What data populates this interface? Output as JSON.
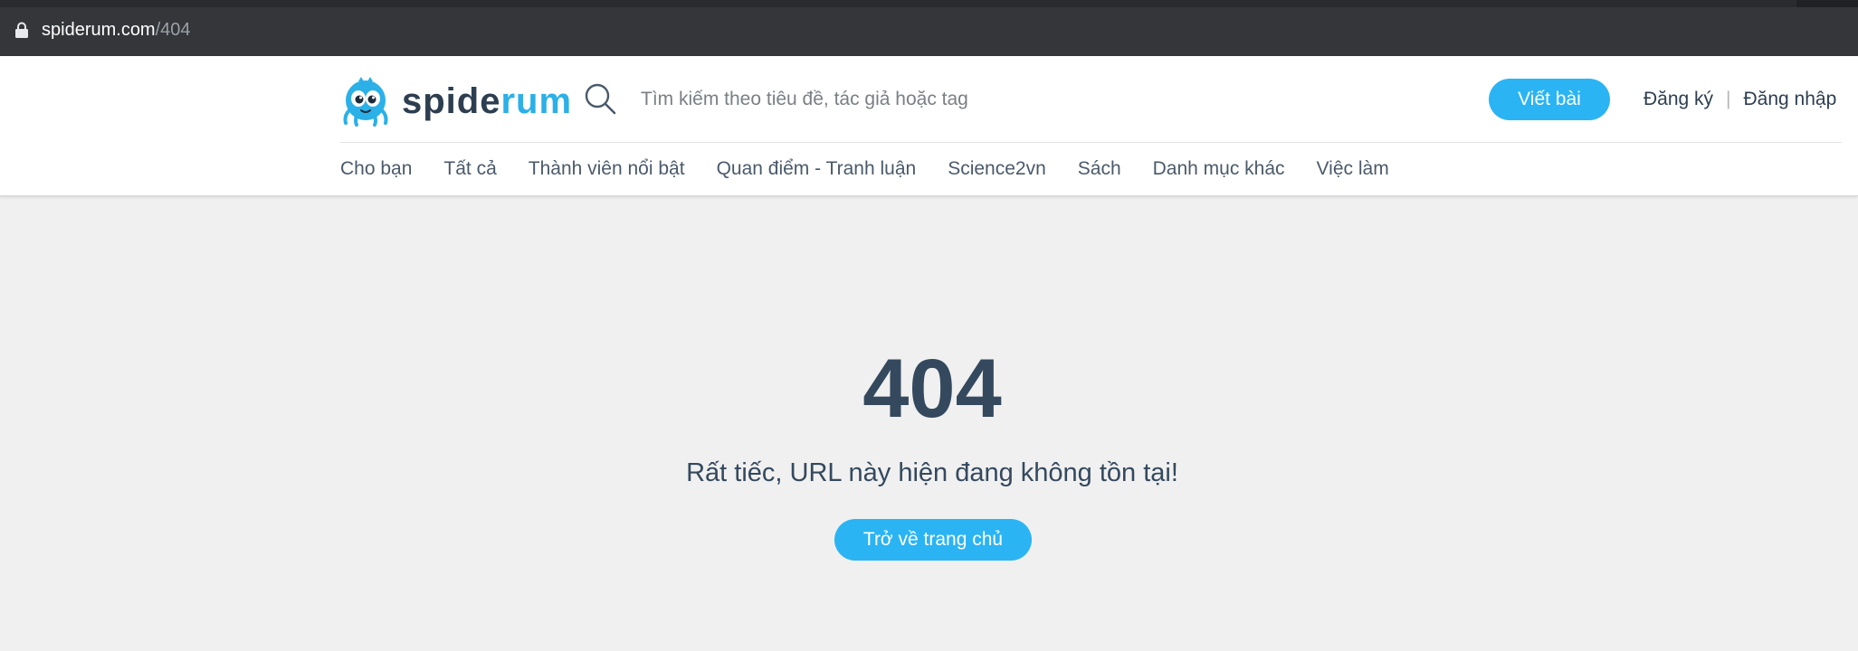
{
  "browser": {
    "url_host": "spiderum.com",
    "url_path": "/404"
  },
  "header": {
    "logo": {
      "text_dark": "spide",
      "text_accent": "rum"
    },
    "search": {
      "placeholder": "Tìm kiếm theo tiêu đề, tác giả hoặc tag"
    },
    "write_button": "Viết bài",
    "register_link": "Đăng ký",
    "separator": "|",
    "login_link": "Đăng nhập",
    "nav": [
      {
        "label": "Cho bạn"
      },
      {
        "label": "Tất cả"
      },
      {
        "label": "Thành viên nổi bật"
      },
      {
        "label": "Quan điểm - Tranh luận"
      },
      {
        "label": "Science2vn"
      },
      {
        "label": "Sách"
      },
      {
        "label": "Danh mục khác"
      },
      {
        "label": "Việc làm"
      }
    ]
  },
  "error": {
    "code": "404",
    "message": "Rất tiếc, URL này hiện đang không tồn tại!",
    "home_button": "Trở về trang chủ"
  },
  "colors": {
    "accent": "#2ab4f3",
    "text_dark": "#34495e",
    "background": "#f0f0f0",
    "browser_bar": "#35363a"
  },
  "icons": {
    "lock": "lock-icon",
    "search": "search-icon",
    "mascot": "spider-mascot-icon"
  }
}
